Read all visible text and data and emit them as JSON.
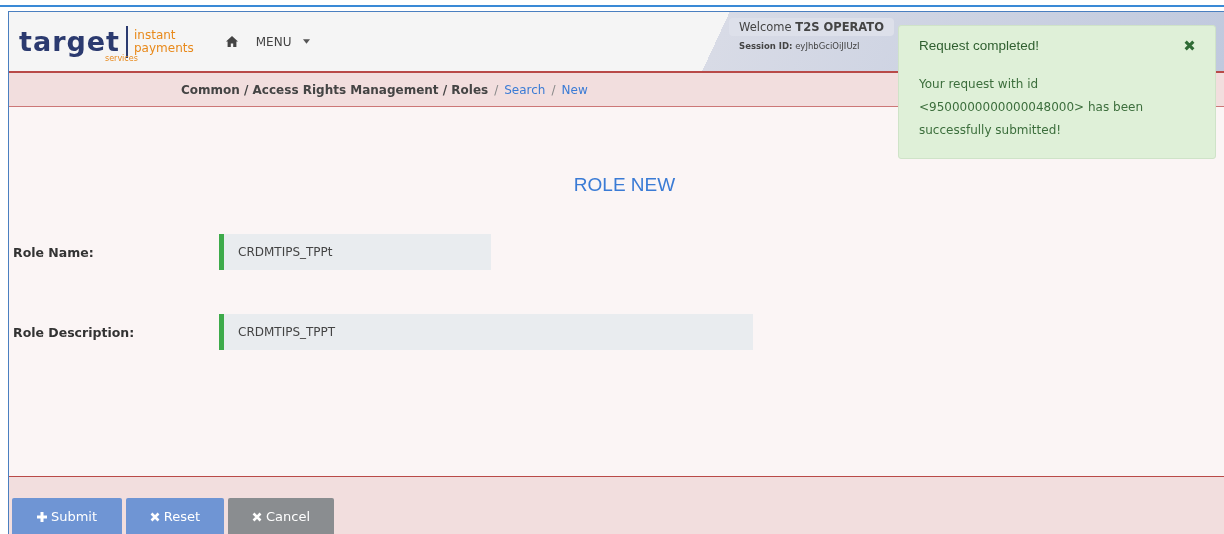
{
  "header": {
    "logo_word": "target",
    "logo_sub": "services",
    "logo_product": [
      "instant",
      "payments"
    ],
    "menu": "MENU",
    "welcome": "Welcome",
    "user": "T2S OPERATO",
    "session_label": "Session ID:",
    "session_value": "eyJhbGciOiJIUzI"
  },
  "breadcrumb": [
    {
      "label": "Common / Access Rights Management / Roles",
      "kind": "path"
    },
    {
      "separator": "/",
      "label": "Search",
      "kind": "link"
    },
    {
      "separator": "/",
      "label": "New",
      "kind": "link"
    }
  ],
  "title": "ROLE NEW",
  "fields": [
    {
      "label": "Role Name:",
      "value": "CRDMTIPS_TPPt",
      "wide": false
    },
    {
      "label": "Role Description:",
      "value": "CRDMTIPS_TPPT",
      "wide": true
    }
  ],
  "buttons": [
    {
      "label": "Submit",
      "kind": "submit"
    },
    {
      "label": "Reset",
      "kind": "reset"
    },
    {
      "label": "Cancel",
      "kind": "cancel"
    }
  ],
  "toast": {
    "title": "Request completed!",
    "message": "Your request with id <9500000000000048000> has been successfully submitted!"
  }
}
